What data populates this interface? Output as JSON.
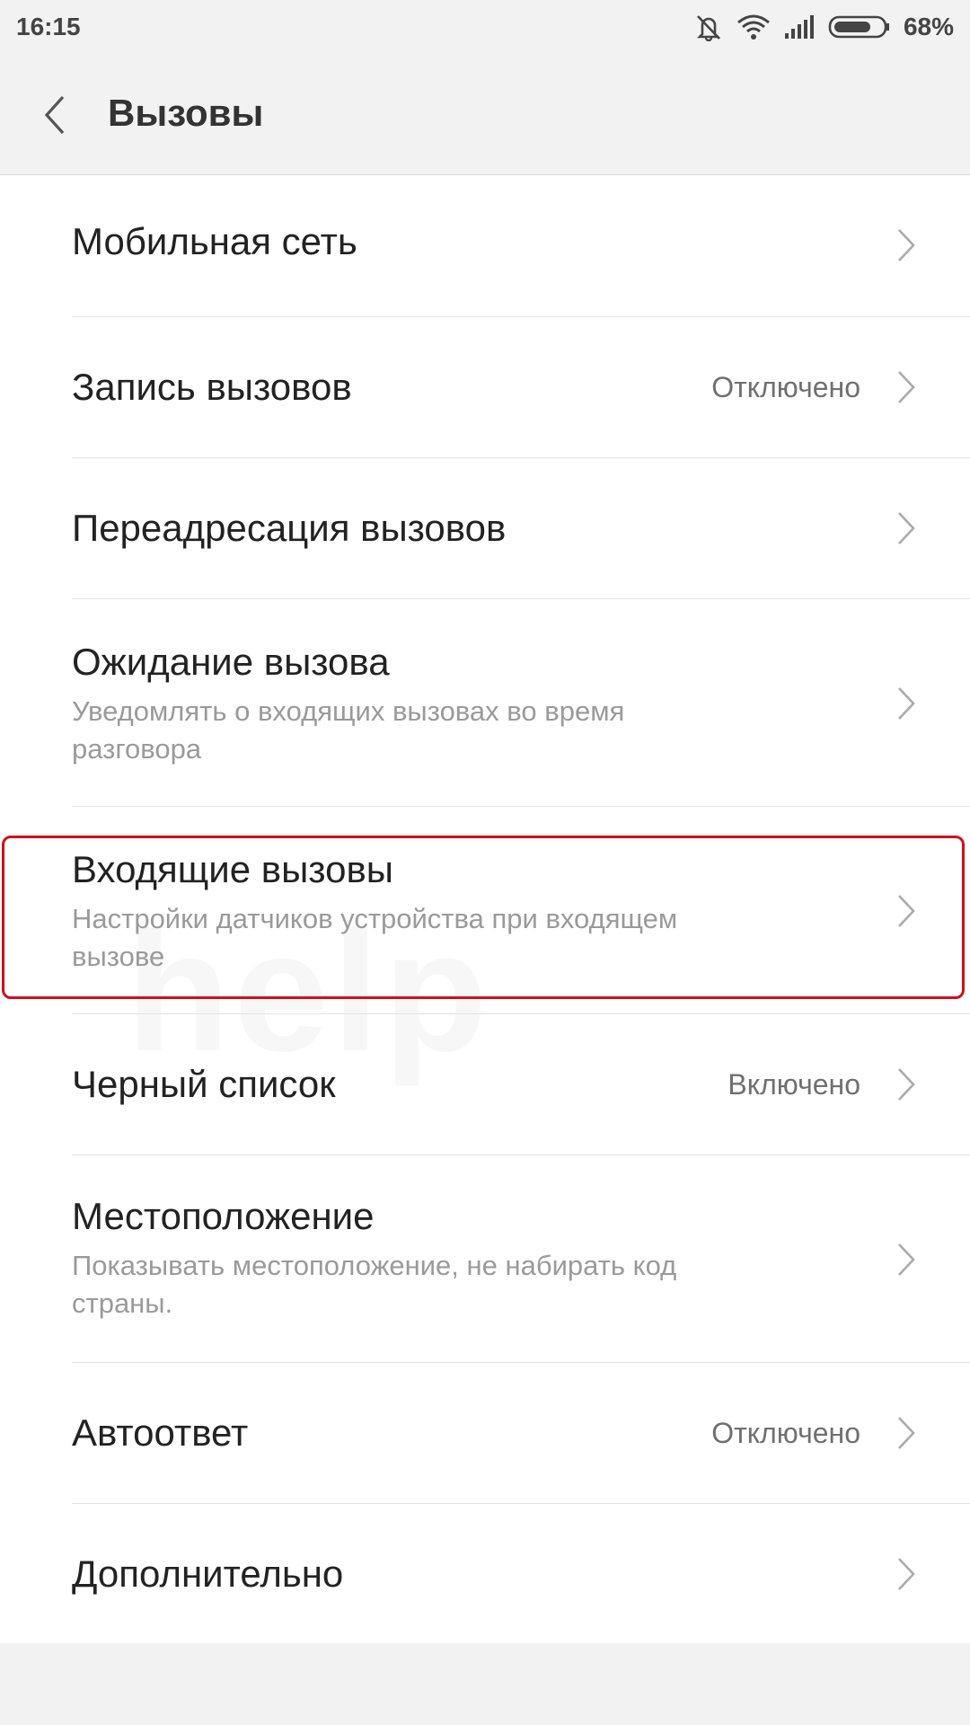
{
  "status_bar": {
    "time": "16:15",
    "battery": "68%",
    "icons": [
      "mute-icon",
      "wifi-icon",
      "signal-icon",
      "battery-icon"
    ]
  },
  "header": {
    "back_icon": "chevron-left-icon",
    "title": "Вызовы"
  },
  "settings": {
    "items": [
      {
        "title": "Мобильная сеть"
      },
      {
        "title": "Запись вызовов",
        "value": "Отключено"
      },
      {
        "title": "Переадресация вызовов"
      },
      {
        "title": "Ожидание вызова",
        "subtitle": "Уведомлять о входящих вызовах во время разговора"
      },
      {
        "title": "Входящие вызовы",
        "subtitle": "Настройки датчиков устройства при входящем вызове"
      },
      {
        "title": "Черный список",
        "value": "Включено"
      },
      {
        "title": "Местоположение",
        "subtitle": "Показывать местоположение, не набирать код страны."
      },
      {
        "title": "Автоответ",
        "value": "Отключено"
      },
      {
        "title": "Дополнительно"
      }
    ]
  },
  "colors": {
    "highlight": "#d0101c",
    "background": "#f2f2f2",
    "list_background": "#ffffff"
  }
}
